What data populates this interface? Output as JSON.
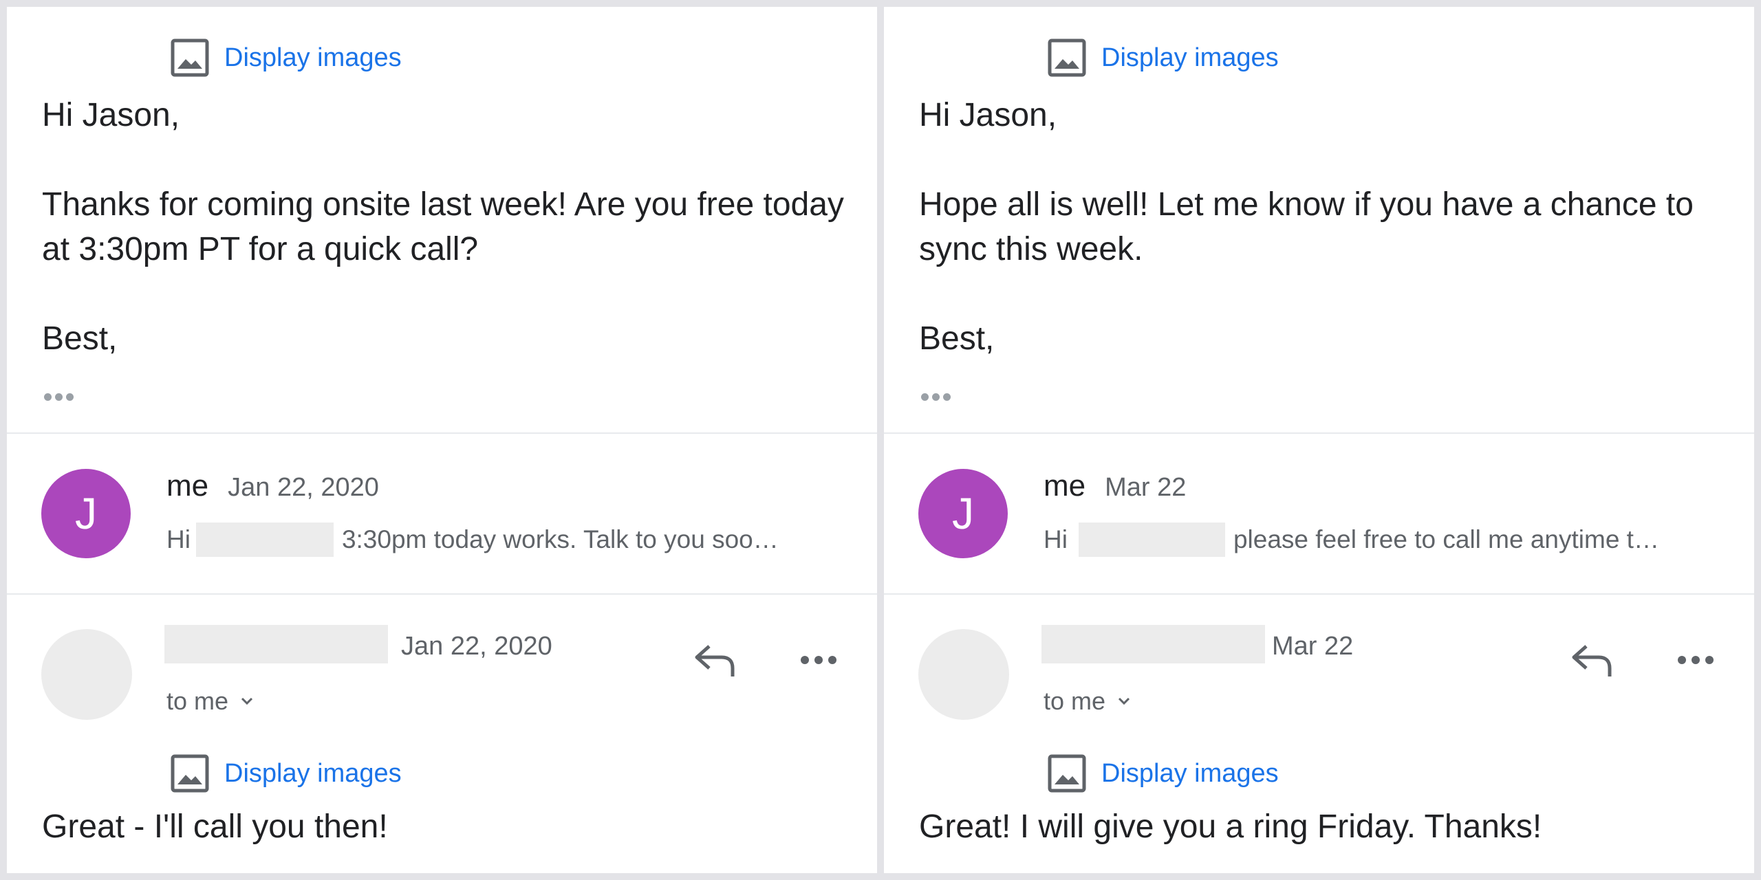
{
  "left": {
    "display_images": "Display images",
    "body_text": "Hi Jason,\n\nThanks for coming onsite last week! Are you free today at 3:30pm PT for a quick call?\n\nBest,",
    "me_sender": "me",
    "me_date": "Jan 22, 2020",
    "avatar_letter": "J",
    "snippet_prefix": "Hi",
    "snippet_text": "3:30pm today works. Talk to you soo…",
    "reply_date": "Jan 22, 2020",
    "to_me": "to me",
    "display_images_2": "Display images",
    "reply_body": "Great - I'll call you then!"
  },
  "right": {
    "display_images": "Display images",
    "body_text": "Hi Jason,\n\nHope all is well! Let me know if you have a chance to sync this week.\n\nBest,",
    "me_sender": "me",
    "me_date": "Mar 22",
    "avatar_letter": "J",
    "snippet_prefix": "Hi",
    "snippet_text": "please feel free to call me anytime t…",
    "reply_date": "Mar 22",
    "to_me": "to me",
    "display_images_2": "Display images",
    "reply_body": "Great! I will give you a ring Friday. Thanks!"
  },
  "icons": {
    "image": "image-icon",
    "reply": "reply-icon",
    "more": "more-horizontal-icon",
    "chevron": "chevron-down-icon"
  },
  "colors": {
    "link": "#1a73e8",
    "avatar": "#ab47bc",
    "redaction": "#ececec"
  }
}
